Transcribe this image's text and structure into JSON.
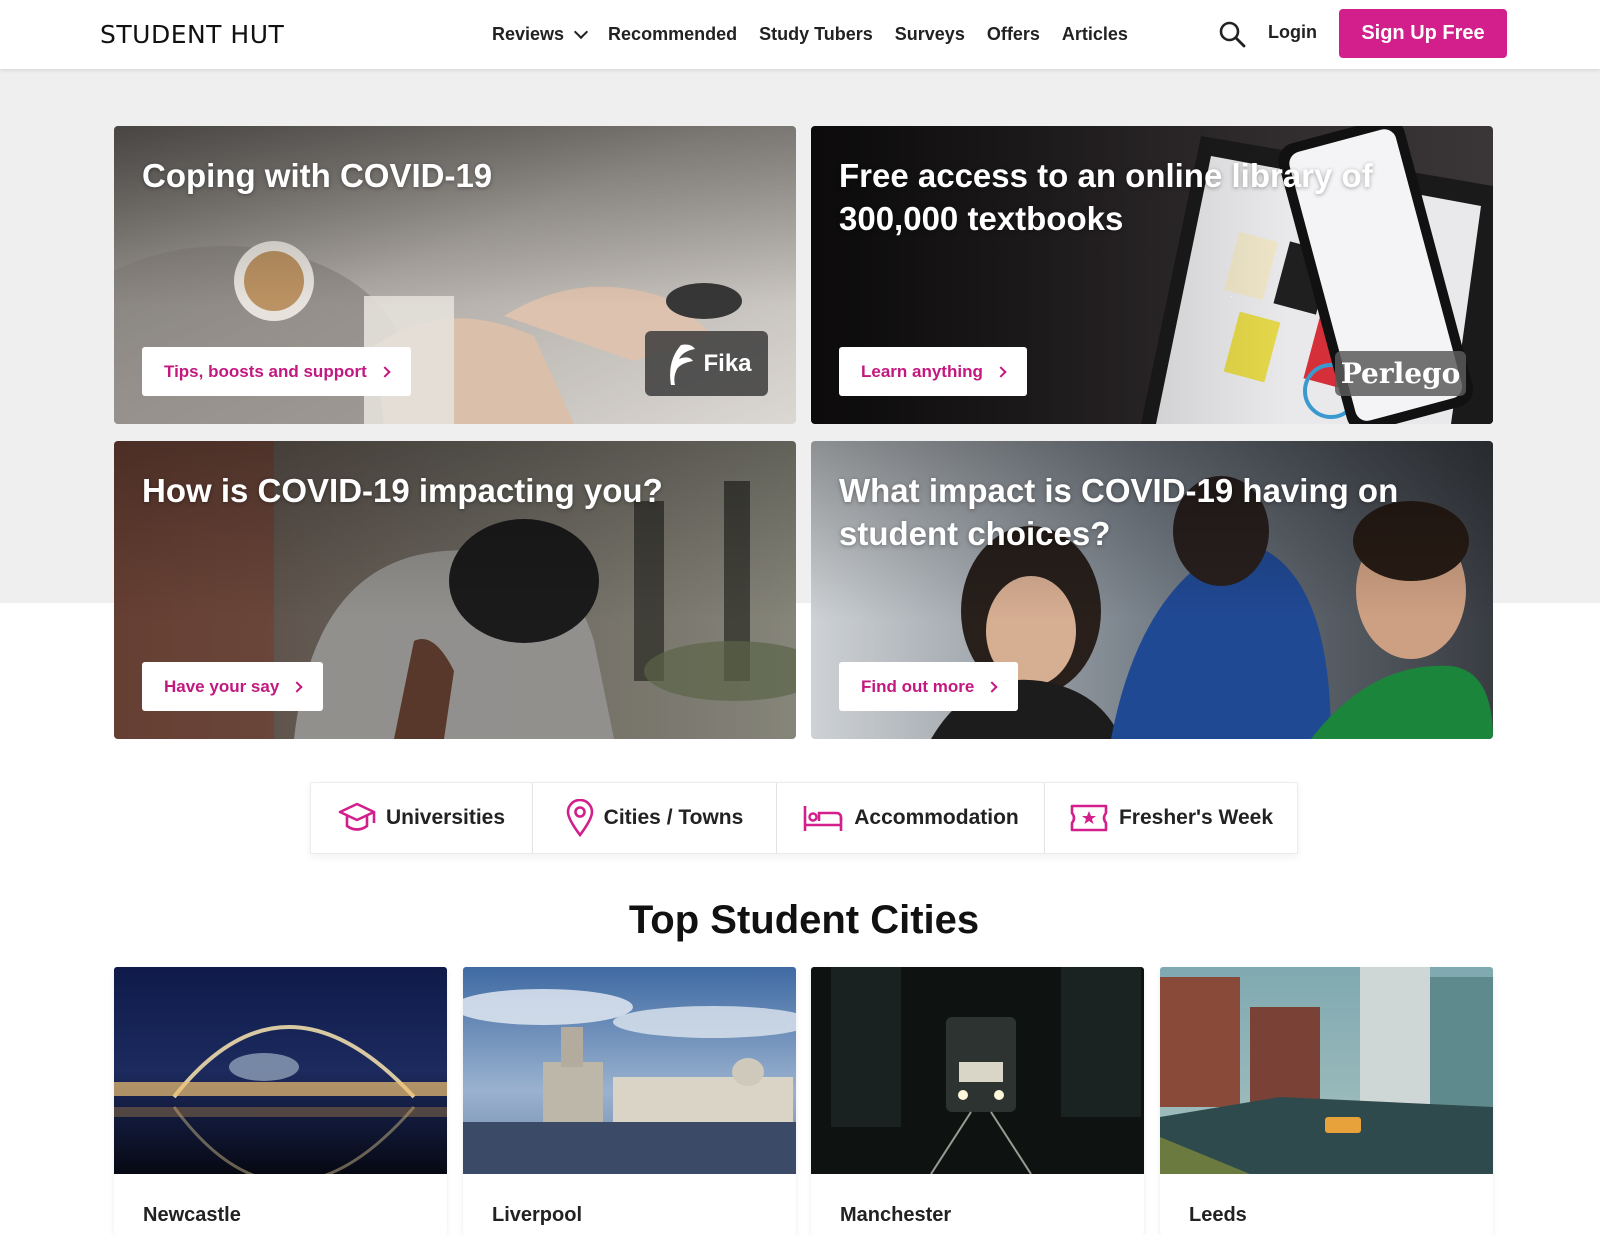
{
  "header": {
    "logo": "STUDENT HUT",
    "nav": [
      {
        "label": "Reviews"
      },
      {
        "label": "Recommended"
      },
      {
        "label": "Study Tubers"
      },
      {
        "label": "Surveys"
      },
      {
        "label": "Offers"
      },
      {
        "label": "Articles"
      }
    ],
    "login": "Login",
    "signup": "Sign Up Free"
  },
  "hero": {
    "cards": [
      {
        "title": "Coping with COVID-19",
        "button": "Tips, boosts and support",
        "sponsor": "Fika"
      },
      {
        "title": "Free access to an online library of 300,000 textbooks",
        "button": "Learn anything",
        "sponsor": "Perlego"
      },
      {
        "title": "How is COVID-19 impacting you?",
        "button": "Have your say"
      },
      {
        "title": "What impact is COVID-19 having on student choices?",
        "button": "Find out more"
      }
    ]
  },
  "categories": [
    {
      "label": "Universities",
      "icon": "graduation-cap-icon"
    },
    {
      "label": "Cities / Towns",
      "icon": "map-pin-icon"
    },
    {
      "label": "Accommodation",
      "icon": "bed-icon"
    },
    {
      "label": "Fresher's Week",
      "icon": "ticket-star-icon"
    }
  ],
  "top_cities": {
    "title": "Top Student Cities",
    "cities": [
      {
        "name": "Newcastle"
      },
      {
        "name": "Liverpool"
      },
      {
        "name": "Manchester"
      },
      {
        "name": "Leeds"
      }
    ]
  },
  "colors": {
    "accent": "#d21f8c",
    "hero_bg": "#efefef"
  }
}
